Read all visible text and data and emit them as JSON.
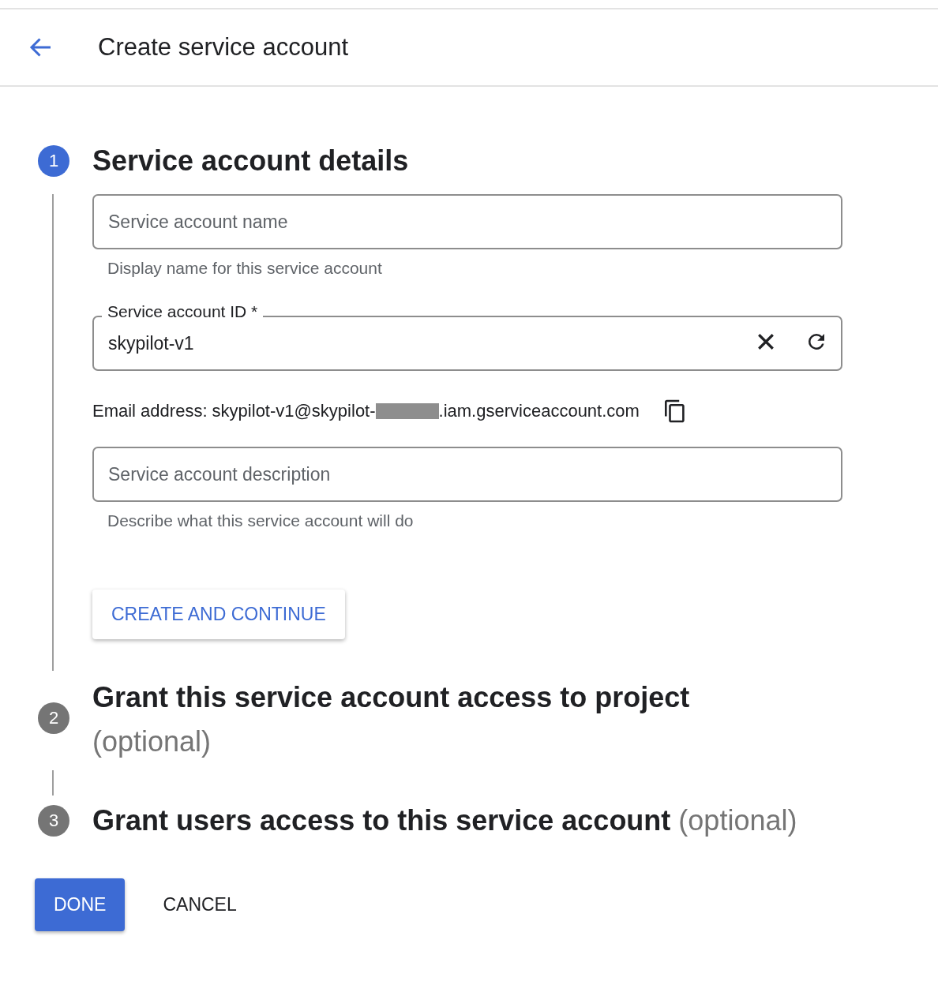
{
  "header": {
    "title": "Create service account"
  },
  "steps": [
    {
      "number": "1",
      "title": "Service account details",
      "selected": true
    },
    {
      "number": "2",
      "title": "Grant this service account access to project",
      "optional": "(optional)",
      "selected": false
    },
    {
      "number": "3",
      "title": "Grant users access to this service account",
      "optional": "(optional)",
      "selected": false
    }
  ],
  "details": {
    "name_field": {
      "placeholder": "Service account name",
      "helper": "Display name for this service account"
    },
    "id_field": {
      "label": "Service account ID *",
      "value": "skypilot-v1"
    },
    "email": {
      "prefix": "Email address: skypilot-v1@skypilot-",
      "suffix": ".iam.gserviceaccount.com"
    },
    "description_field": {
      "placeholder": "Service account description",
      "helper": "Describe what this service account will do"
    },
    "create_button": "CREATE AND CONTINUE"
  },
  "actions": {
    "done": "DONE",
    "cancel": "CANCEL"
  }
}
